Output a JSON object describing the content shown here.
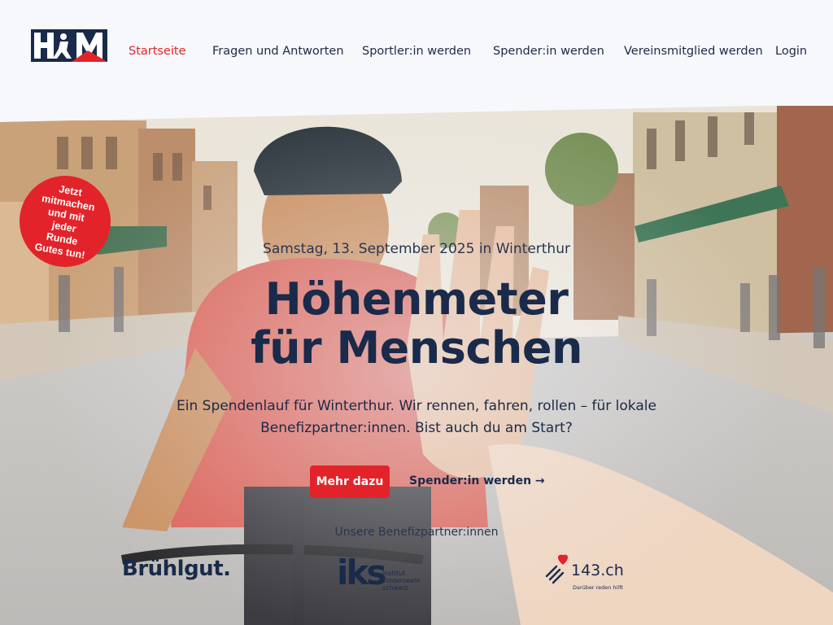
{
  "brand": {
    "logo_text": "H4M",
    "accent": "#e3232a",
    "navy": "#1a2a4a"
  },
  "nav": {
    "items": [
      {
        "label": "Startseite",
        "active": true
      },
      {
        "label": "Fragen und Antworten"
      },
      {
        "label": "Sportler:in werden"
      },
      {
        "label": "Spender:in werden"
      },
      {
        "label": "Vereinsmitglied werden"
      },
      {
        "label": "Login"
      }
    ]
  },
  "badge": {
    "text": "Jetzt\nmitmachen\nund mit\njeder\nRunde\nGutes tun!"
  },
  "hero": {
    "date": "Samstag, 13. September 2025 in Winterthur",
    "title_line1": "Höhenmeter",
    "title_line2": "für Menschen",
    "lead": "Ein Spendenlauf für Winterthur. Wir rennen, fahren, rollen – für lokale Benefizpartner:innen. Bist auch du am Start?",
    "cta_primary": "Mehr dazu",
    "cta_secondary": "Spender:in werden →",
    "image": "cyclist-high-five-street-photo"
  },
  "partners": {
    "label": "Unsere Benefizpartner:innen",
    "items": [
      {
        "name": "Brühlgut."
      },
      {
        "name": "iks",
        "text": "institut\nkinderseele\nschweiz"
      },
      {
        "name": "143.ch",
        "claim": "Darüber reden hilft",
        "icon": "heart-icon"
      }
    ]
  }
}
